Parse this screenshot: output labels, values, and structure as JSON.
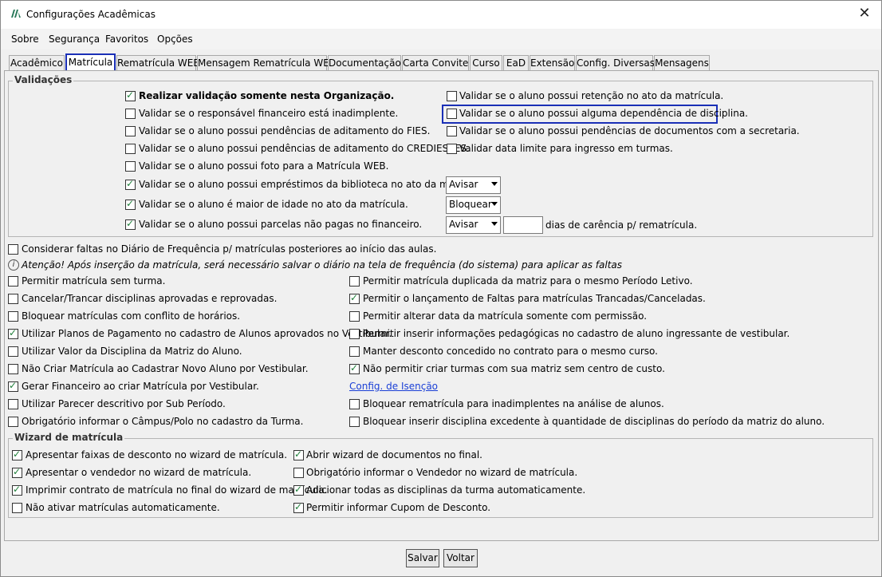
{
  "window": {
    "title": "Configurações Acadêmicas",
    "close": "✕"
  },
  "menu": [
    "Sobre",
    "Segurança",
    "Favoritos",
    "Opções"
  ],
  "tabs": [
    "Acadêmico",
    "Matrícula",
    "Rematrícula WEB",
    "Mensagem Rematrícula WEB",
    "Documentação",
    "Carta Convite",
    "Curso",
    "EaD",
    "Extensão",
    "Config. Diversas",
    "Mensagens"
  ],
  "active_tab": "Matrícula",
  "validacoes": {
    "title": "Validações",
    "left": [
      {
        "label": "Realizar validação somente nesta Organização.",
        "checked": true,
        "bold": true
      },
      {
        "label": "Validar se o responsável financeiro está inadimplente.",
        "checked": false
      },
      {
        "label": "Validar se o aluno possui pendências de aditamento do FIES.",
        "checked": false
      },
      {
        "label": "Validar se o aluno possui pendências de aditamento do CREDIES/IES.",
        "checked": false
      },
      {
        "label": "Validar se o aluno possui foto para a Matrícula WEB.",
        "checked": false
      },
      {
        "label": "Validar se o aluno possui empréstimos da biblioteca no ato da matrícula.",
        "checked": true
      },
      {
        "label": "Validar se o aluno é maior de idade no ato da matrícula.",
        "checked": true
      },
      {
        "label": "Validar se o aluno possui parcelas não pagas no financeiro.",
        "checked": true
      }
    ],
    "right": [
      {
        "label": "Validar se o aluno possui retenção no ato da matrícula.",
        "checked": false
      },
      {
        "label": "Validar se o aluno possui alguma dependência de disciplina.",
        "checked": false
      },
      {
        "label": "Validar se o aluno possui pendências de documentos com a secretaria.",
        "checked": false
      },
      {
        "label": "Validar data limite para ingresso em turmas.",
        "checked": false
      }
    ],
    "select_biblioteca": "Avisar",
    "select_idade": "Bloquear",
    "select_parcelas": "Avisar",
    "carencia_value": "",
    "carencia_label": "dias de carência p/ rematrícula."
  },
  "faltas": {
    "label": "Considerar faltas no Diário de Frequência p/ matrículas posteriores ao início das aulas.",
    "checked": false
  },
  "info_icon": "i",
  "note": "Atenção! Após inserção da matrícula, será necessário salvar o diário na tela de frequência (do sistema) para aplicar as faltas",
  "options_left": [
    {
      "label": "Permitir matrícula sem turma.",
      "checked": false
    },
    {
      "label": "Cancelar/Trancar disciplinas aprovadas e reprovadas.",
      "checked": false
    },
    {
      "label": "Bloquear matrículas com conflito de horários.",
      "checked": false
    },
    {
      "label": "Utilizar Planos de Pagamento no cadastro de Alunos aprovados no Vestibular.",
      "checked": true
    },
    {
      "label": "Utilizar Valor da Disciplina da Matriz do Aluno.",
      "checked": false
    },
    {
      "label": "Não Criar Matrícula ao Cadastrar Novo Aluno por Vestibular.",
      "checked": false
    },
    {
      "label": "Gerar Financeiro ao criar Matrícula por Vestibular.",
      "checked": true
    },
    {
      "label": "Utilizar Parecer descritivo por Sub Período.",
      "checked": false
    },
    {
      "label": "Obrigatório informar o Câmpus/Polo no cadastro da Turma.",
      "checked": false
    }
  ],
  "options_right": [
    {
      "label": "Permitir matrícula duplicada da matriz para o mesmo Período Letivo.",
      "checked": false
    },
    {
      "label": "Permitir o lançamento de Faltas para matrículas Trancadas/Canceladas.",
      "checked": true
    },
    {
      "label": "Permitir alterar data da matrícula somente com permissão.",
      "checked": false
    },
    {
      "label": "Permitir inserir informações pedagógicas no cadastro de aluno ingressante de vestibular.",
      "checked": false
    },
    {
      "label": "Manter desconto concedido no contrato para o mesmo curso.",
      "checked": false
    },
    {
      "label": "Não permitir criar turmas com sua matriz sem centro de custo.",
      "checked": true
    },
    {
      "label": "Bloquear rematrícula para inadimplentes na análise de alunos.",
      "checked": false
    },
    {
      "label": "Bloquear inserir disciplina excedente à quantidade de disciplinas do período da matriz do aluno.",
      "checked": false
    }
  ],
  "link_isencao": "Config. de Isenção",
  "wizard": {
    "title": "Wizard de matrícula",
    "left": [
      {
        "label": "Apresentar faixas de desconto no wizard de matrícula.",
        "checked": true
      },
      {
        "label": "Apresentar o vendedor no wizard de matrícula.",
        "checked": true
      },
      {
        "label": "Imprimir contrato de matrícula no final do wizard de matrícula.",
        "checked": true
      },
      {
        "label": "Não ativar matrículas automaticamente.",
        "checked": false
      }
    ],
    "right": [
      {
        "label": "Abrir wizard de documentos no final.",
        "checked": true
      },
      {
        "label": "Obrigatório informar o Vendedor no wizard de matrícula.",
        "checked": false
      },
      {
        "label": "Adicionar todas as disciplinas da turma automaticamente.",
        "checked": true
      },
      {
        "label": "Permitir informar Cupom de Desconto.",
        "checked": true
      }
    ]
  },
  "buttons": {
    "save": "Salvar",
    "back": "Voltar"
  }
}
